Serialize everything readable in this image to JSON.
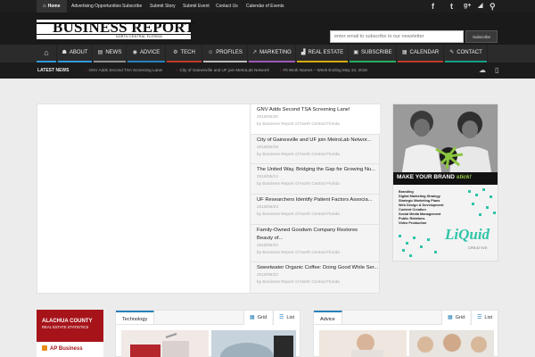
{
  "topbar": {
    "links": [
      "Home",
      "Advertising Opportunities",
      "Subscribe",
      "Submit Story",
      "Submit Event",
      "Contact Us",
      "Calendar of Events"
    ],
    "social_icons": [
      "facebook-icon",
      "twitter-icon",
      "google-plus-icon",
      "rss-icon",
      "search-icon"
    ],
    "social_glyphs": [
      "f",
      "t",
      "g+",
      "◢",
      "⚲"
    ]
  },
  "header": {
    "logo_text": "BUSINESS REPORT",
    "logo_sub": "NORTH CENTRAL FLORIDA",
    "newsletter_placeholder": "enter email to subscribe to our newsletter",
    "newsletter_button": "Subscribe"
  },
  "nav": {
    "items": [
      {
        "label": "",
        "icon": "home-icon",
        "glyph": "⌂",
        "color": "#3498db"
      },
      {
        "label": "ABOUT",
        "icon": "people-icon",
        "glyph": "☗",
        "color": "#3498db"
      },
      {
        "label": "NEWS",
        "icon": "newspaper-icon",
        "glyph": "▤",
        "color": "#8e8e8e"
      },
      {
        "label": "ADVICE",
        "icon": "advice-icon",
        "glyph": "◉",
        "color": "#2980b9"
      },
      {
        "label": "TECH",
        "icon": "gear-icon",
        "glyph": "⚙",
        "color": "#c0392b"
      },
      {
        "label": "PROFILES",
        "icon": "user-icon",
        "glyph": "☺",
        "color": "#bbbbbb"
      },
      {
        "label": "MARKETING",
        "icon": "chart-icon",
        "glyph": "↗",
        "color": "#9b59b6"
      },
      {
        "label": "REAL ESTATE",
        "icon": "bar-chart-icon",
        "glyph": "▟",
        "color": "#d4ac0d"
      },
      {
        "label": "SUBSCRIBE",
        "icon": "card-icon",
        "glyph": "▣",
        "color": "#27ae60"
      },
      {
        "label": "CALENDAR",
        "icon": "calendar-icon",
        "glyph": "▦",
        "color": "#c0392b"
      },
      {
        "label": "CONTACT",
        "icon": "pencil-icon",
        "glyph": "✎",
        "color": "#16a085"
      }
    ]
  },
  "ticker": {
    "label": "LATEST NEWS",
    "items": [
      "GNV Adds Second TSA Screening Lane!",
      "City of Gainesville and UF join MetroLab Network",
      "Fit Work Names – Week Ending May 24, 2018"
    ],
    "icons": [
      "weather-icon",
      "book-icon"
    ]
  },
  "slider": {
    "posts": [
      {
        "title": "GNV Adds Second TSA Screening Lane!",
        "date": "2018/05/30",
        "author": "by Business Report of North Central Florida"
      },
      {
        "title": "City of Gainesville and UF join MetroLab Networ...",
        "date": "2018/05/29",
        "author": "by Business Report of North Central Florida"
      },
      {
        "title": "The United Way, Bridging the Gap for Growing Nu...",
        "date": "2018/05/24",
        "author": "by Business Report of North Central Florida"
      },
      {
        "title": "UF Researchers Identify Patient Factors Associa...",
        "date": "2018/05/23",
        "author": "by Business Report of North Central Florida"
      },
      {
        "title": "Family-Owned Goodwin Company Restores Beauty of...",
        "date": "2018/05/22",
        "author": "by Business Report of North Central Florida"
      },
      {
        "title": "Sweetwater Organic Coffee: Doing Good While Ser...",
        "date": "2018/05/22",
        "author": "by Business Report of North Central Florida"
      }
    ]
  },
  "ad": {
    "tagline_a": "MAKE YOUR BRAND ",
    "tagline_b": "stick!",
    "services": [
      "Branding",
      "Digital Marketing Strategy",
      "Strategic Marketing Plans",
      "Web Design & Development",
      "Content Creation",
      "Social Media Management",
      "Public Relations",
      "Video Production"
    ],
    "brand": "LiQuid",
    "brand_sub": "CREATIVE"
  },
  "widgets": {
    "alachua": {
      "title": "ALACHUA COUNTY",
      "subtitle": "REAL ESTATE STATISTICS",
      "item": "AP Business"
    },
    "technology": {
      "tab": "Technology",
      "grid": "Grid",
      "list": "List"
    },
    "advice": {
      "tab": "Advice",
      "grid": "Grid",
      "list": "List"
    }
  }
}
